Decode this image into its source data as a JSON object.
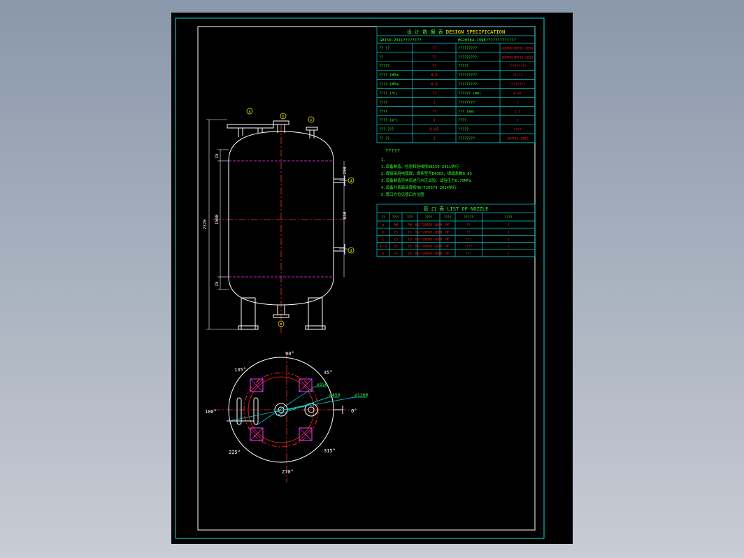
{
  "table_header": {
    "title_cn": "设 计 数 据 表",
    "title_en": "DESIGN SPECIFICATION",
    "line2_left": "GB150-2011????????",
    "line2_right": "HG20584-1998?????????????"
  },
  "spec_rows": [
    {
      "l": "?? ??",
      "lv": "??",
      "r": "?????????",
      "rv": "Q345R/GB713-2014"
    },
    {
      "l": "??",
      "lv": "??",
      "r": "?????????",
      "rv": "Q345R/GB713-2014"
    },
    {
      "l": "?????",
      "lv": "??",
      "r": "?????",
      "rv": "?????????"
    },
    {
      "l": "???? (MPa)",
      "lv": "0.6",
      "r": "?????????",
      "rv": "?????"
    },
    {
      "l": "???? (MPa)",
      "lv": "0.6",
      "r": "?????????",
      "rv": "????????"
    },
    {
      "l": "???? (℃)",
      "lv": "??",
      "r": "?????? (mm)",
      "rv": "0.85"
    },
    {
      "l": "????",
      "lv": "1",
      "r": "????????",
      "rv": "1"
    },
    {
      "l": "????",
      "lv": "??",
      "r": "??? (mm)",
      "rv": "1.5"
    },
    {
      "l": "???? (m³)",
      "lv": "1",
      "r": "????",
      "rv": "1"
    },
    {
      "l": "??? ???",
      "lv": "0.85",
      "r": "?????",
      "rv": "????"
    },
    {
      "l": "?? ??",
      "lv": "1",
      "r": "????????",
      "rv": "JB4711-1992"
    }
  ],
  "notes": {
    "title": "?????",
    "lines": [
      "1.",
      "1.设备制造、检验和验收按GB150-2011执行",
      "2.焊接采用电弧焊，焊条型号E4303，焊缝系数0.85",
      "3.设备制造完毕后进行水压试验，试验压力0.75MPa",
      "4.设备外表面涂漆按HG/T20679-2014执行",
      "5.管口方位见管口方位图"
    ]
  },
  "nozzle_table": {
    "title_cn": "管 口 表",
    "title_en": "LIST OF NOZZLE",
    "headers": [
      "??",
      "????",
      "???",
      "????",
      "????",
      "?????",
      "????"
    ],
    "rows": [
      [
        "a",
        "DN",
        "PN",
        "HG/T20592-2009",
        "RF",
        "??",
        "1"
      ],
      [
        "b",
        "25",
        "16",
        "HG/T20592-2009",
        "RF",
        "??",
        "1"
      ],
      [
        "c",
        "25",
        "16",
        "HG/T20592-2009",
        "RF",
        "???",
        "1"
      ],
      [
        "d1-2",
        "25",
        "16",
        "HG/T20592-2009",
        "RF",
        "????",
        "1"
      ],
      [
        "e",
        "25",
        "16",
        "HG/T20592-2009",
        "RF",
        "???",
        "1"
      ]
    ]
  },
  "elevation": {
    "labels": {
      "a": "a",
      "b": "b",
      "c": "c",
      "d1": "d",
      "d2": "d",
      "e": "e"
    },
    "dims": {
      "total": "2370",
      "straight": "1500",
      "top": "25",
      "bottom": "25",
      "n1": "200",
      "n2": "850"
    }
  },
  "plan": {
    "angles": {
      "a0": "0°",
      "a45": "45°",
      "a90": "90°",
      "a135": "135°",
      "a180": "180°",
      "a225": "225°",
      "a270": "270°",
      "a315": "315°"
    },
    "leaders": {
      "d1": "ø150",
      "d2": "ø450",
      "d3": "ø1200"
    }
  },
  "colors": {
    "frame": "#00e5e5",
    "border": "#ffffff",
    "table": "#00d0d0",
    "text": "#33ff33",
    "red": "#ff2020",
    "magenta": "#ff33ff",
    "yellow": "#ffff00",
    "center": "#ff3030"
  }
}
